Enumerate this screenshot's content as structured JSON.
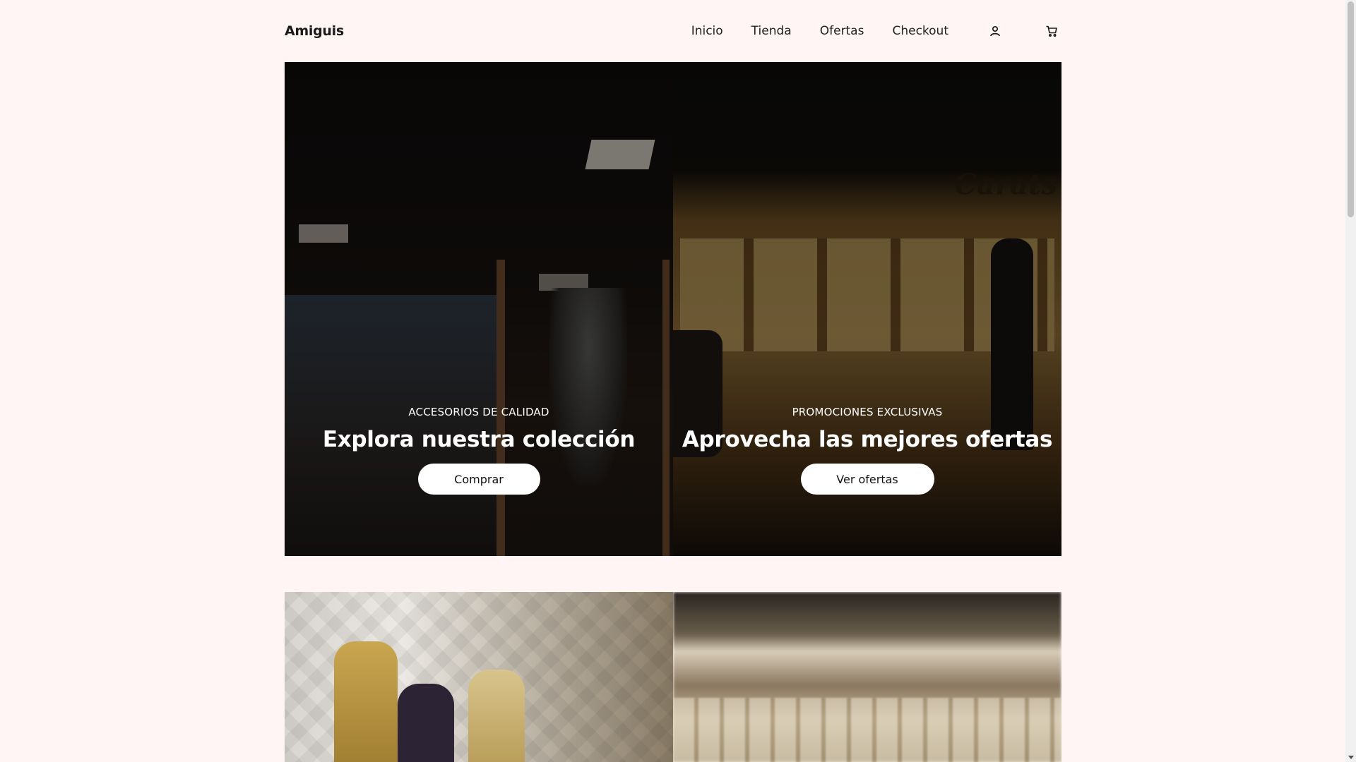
{
  "header": {
    "brand": "Amiguis",
    "nav": [
      {
        "label": "Inicio"
      },
      {
        "label": "Tienda"
      },
      {
        "label": "Ofertas"
      },
      {
        "label": "Checkout"
      }
    ],
    "icons": {
      "account": "user-icon",
      "cart": "cart-icon"
    }
  },
  "hero": [
    {
      "eyebrow": "ACCESORIOS DE CALIDAD",
      "headline": "Explora nuestra colección",
      "button": "Comprar"
    },
    {
      "eyebrow": "PROMOCIONES EXCLUSIVAS",
      "headline": "Aprovecha las mejores ofertas",
      "button": "Ver ofertas",
      "sign_text": "Carats"
    }
  ],
  "colors": {
    "background": "#fff5f5",
    "button_bg": "#ffffff",
    "text": "#1a1a1a"
  }
}
